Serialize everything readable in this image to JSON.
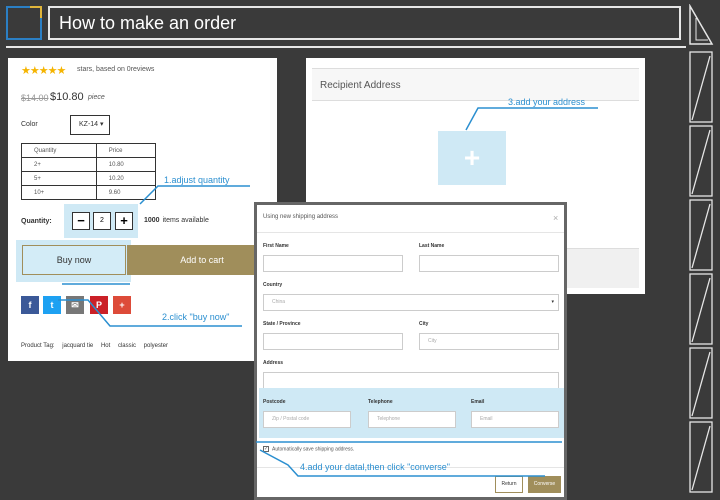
{
  "header": {
    "title": "How to make an order"
  },
  "product": {
    "stars": "★★★★★",
    "stars_text": "stars, based on 0reviews",
    "old_price": "$14.00",
    "new_price": "$10.80",
    "per_piece": "piece",
    "color_label": "Color",
    "color_value": "KZ-14 ▾",
    "table_headers": [
      "Quantity",
      "Price"
    ],
    "table_rows": [
      [
        "2+",
        "10.80"
      ],
      [
        "5+",
        "10.20"
      ],
      [
        "10+",
        "9.60"
      ]
    ],
    "quantity_label": "Quantity:",
    "quantity_minus": "−",
    "quantity_value": "2",
    "quantity_plus": "+",
    "available_count": "1000",
    "available_text": "items available",
    "buy_now": "Buy now",
    "add_to_cart": "Add to cart",
    "social": [
      {
        "name": "facebook-icon",
        "glyph": "f",
        "color": "#3b5998"
      },
      {
        "name": "twitter-icon",
        "glyph": "t",
        "color": "#1da1f2"
      },
      {
        "name": "email-icon",
        "glyph": "✉",
        "color": "#777777"
      },
      {
        "name": "pinterest-icon",
        "glyph": "P",
        "color": "#cb2027"
      },
      {
        "name": "google-plus-icon",
        "glyph": "+",
        "color": "#dd4b39"
      }
    ],
    "tags_label": "Product Tag:",
    "tags": [
      "jacquard tie",
      "Hot",
      "classic",
      "polyester"
    ]
  },
  "recipient": {
    "title": "Recipient Address",
    "add_icon": "+"
  },
  "modal": {
    "title": "Using new shipping address",
    "close": "×",
    "first_name_label": "First Name",
    "last_name_label": "Last Name",
    "country_label": "Country",
    "country_value": "China",
    "state_label": "State / Province",
    "city_label": "City",
    "city_placeholder": "City",
    "address_label": "Address",
    "postcode_label": "Postcode",
    "postcode_placeholder": "Zip / Postal code",
    "telephone_label": "Telephone",
    "telephone_placeholder": "Telephone",
    "email_label": "Email",
    "email_placeholder": "Email",
    "autosave_text": "Automatically save shipping address.",
    "return_label": "Return",
    "converse_label": "Converse"
  },
  "annotations": {
    "step1": "1.adjust quantity",
    "step2": "2.click \"buy now\"",
    "step3": "3.add your address",
    "step4": "4.add your datal,then click \"converse\""
  },
  "colors": {
    "accent_blue": "#2b8fd0",
    "gold": "#a08e5b",
    "highlight": "#cfe9f5"
  }
}
